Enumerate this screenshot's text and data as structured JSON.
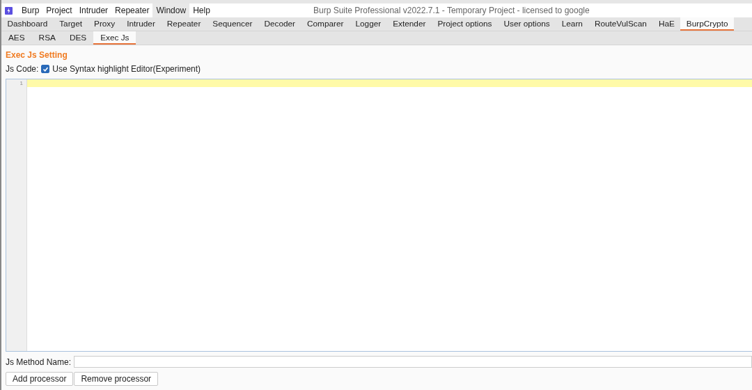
{
  "window": {
    "title": "Burp Suite Professional v2022.7.1 - Temporary Project - licensed to google"
  },
  "menu": [
    {
      "label": "Burp",
      "selected": false
    },
    {
      "label": "Project",
      "selected": false
    },
    {
      "label": "Intruder",
      "selected": false
    },
    {
      "label": "Repeater",
      "selected": false
    },
    {
      "label": "Window",
      "selected": true
    },
    {
      "label": "Help",
      "selected": false
    }
  ],
  "tabs": [
    {
      "label": "Dashboard",
      "selected": false
    },
    {
      "label": "Target",
      "selected": false
    },
    {
      "label": "Proxy",
      "selected": false
    },
    {
      "label": "Intruder",
      "selected": false
    },
    {
      "label": "Repeater",
      "selected": false
    },
    {
      "label": "Sequencer",
      "selected": false
    },
    {
      "label": "Decoder",
      "selected": false
    },
    {
      "label": "Comparer",
      "selected": false
    },
    {
      "label": "Logger",
      "selected": false
    },
    {
      "label": "Extender",
      "selected": false
    },
    {
      "label": "Project options",
      "selected": false
    },
    {
      "label": "User options",
      "selected": false
    },
    {
      "label": "Learn",
      "selected": false
    },
    {
      "label": "RouteVulScan",
      "selected": false
    },
    {
      "label": "HaE",
      "selected": false
    },
    {
      "label": "BurpCrypto",
      "selected": true
    }
  ],
  "subtabs": [
    {
      "label": "AES",
      "selected": false
    },
    {
      "label": "RSA",
      "selected": false
    },
    {
      "label": "DES",
      "selected": false
    },
    {
      "label": "Exec Js",
      "selected": true
    }
  ],
  "section_title": "Exec Js Setting",
  "js_code": {
    "label": "Js Code:",
    "checkbox_label": "Use Syntax highlight Editor(Experiment)",
    "checked": true
  },
  "editor": {
    "line_numbers": [
      "1"
    ]
  },
  "method_name": {
    "label": "Js Method Name:"
  },
  "buttons": [
    "Add processor",
    "Remove processor"
  ]
}
